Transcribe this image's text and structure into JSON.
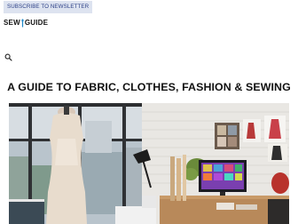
{
  "header": {
    "subscribe_label": "SUBSCRIBE TO NEWSLETTER",
    "logo_left": "SEW",
    "logo_right": "GUIDE"
  },
  "icons": {
    "search": "search-icon",
    "needle": "needle-icon"
  },
  "main": {
    "title": "A GUIDE TO FABRIC, CLOTHES, FASHION & SEWING"
  },
  "colors": {
    "subscribe_bg": "#dde3f0",
    "subscribe_text": "#2b3f86",
    "title_text": "#111111"
  }
}
